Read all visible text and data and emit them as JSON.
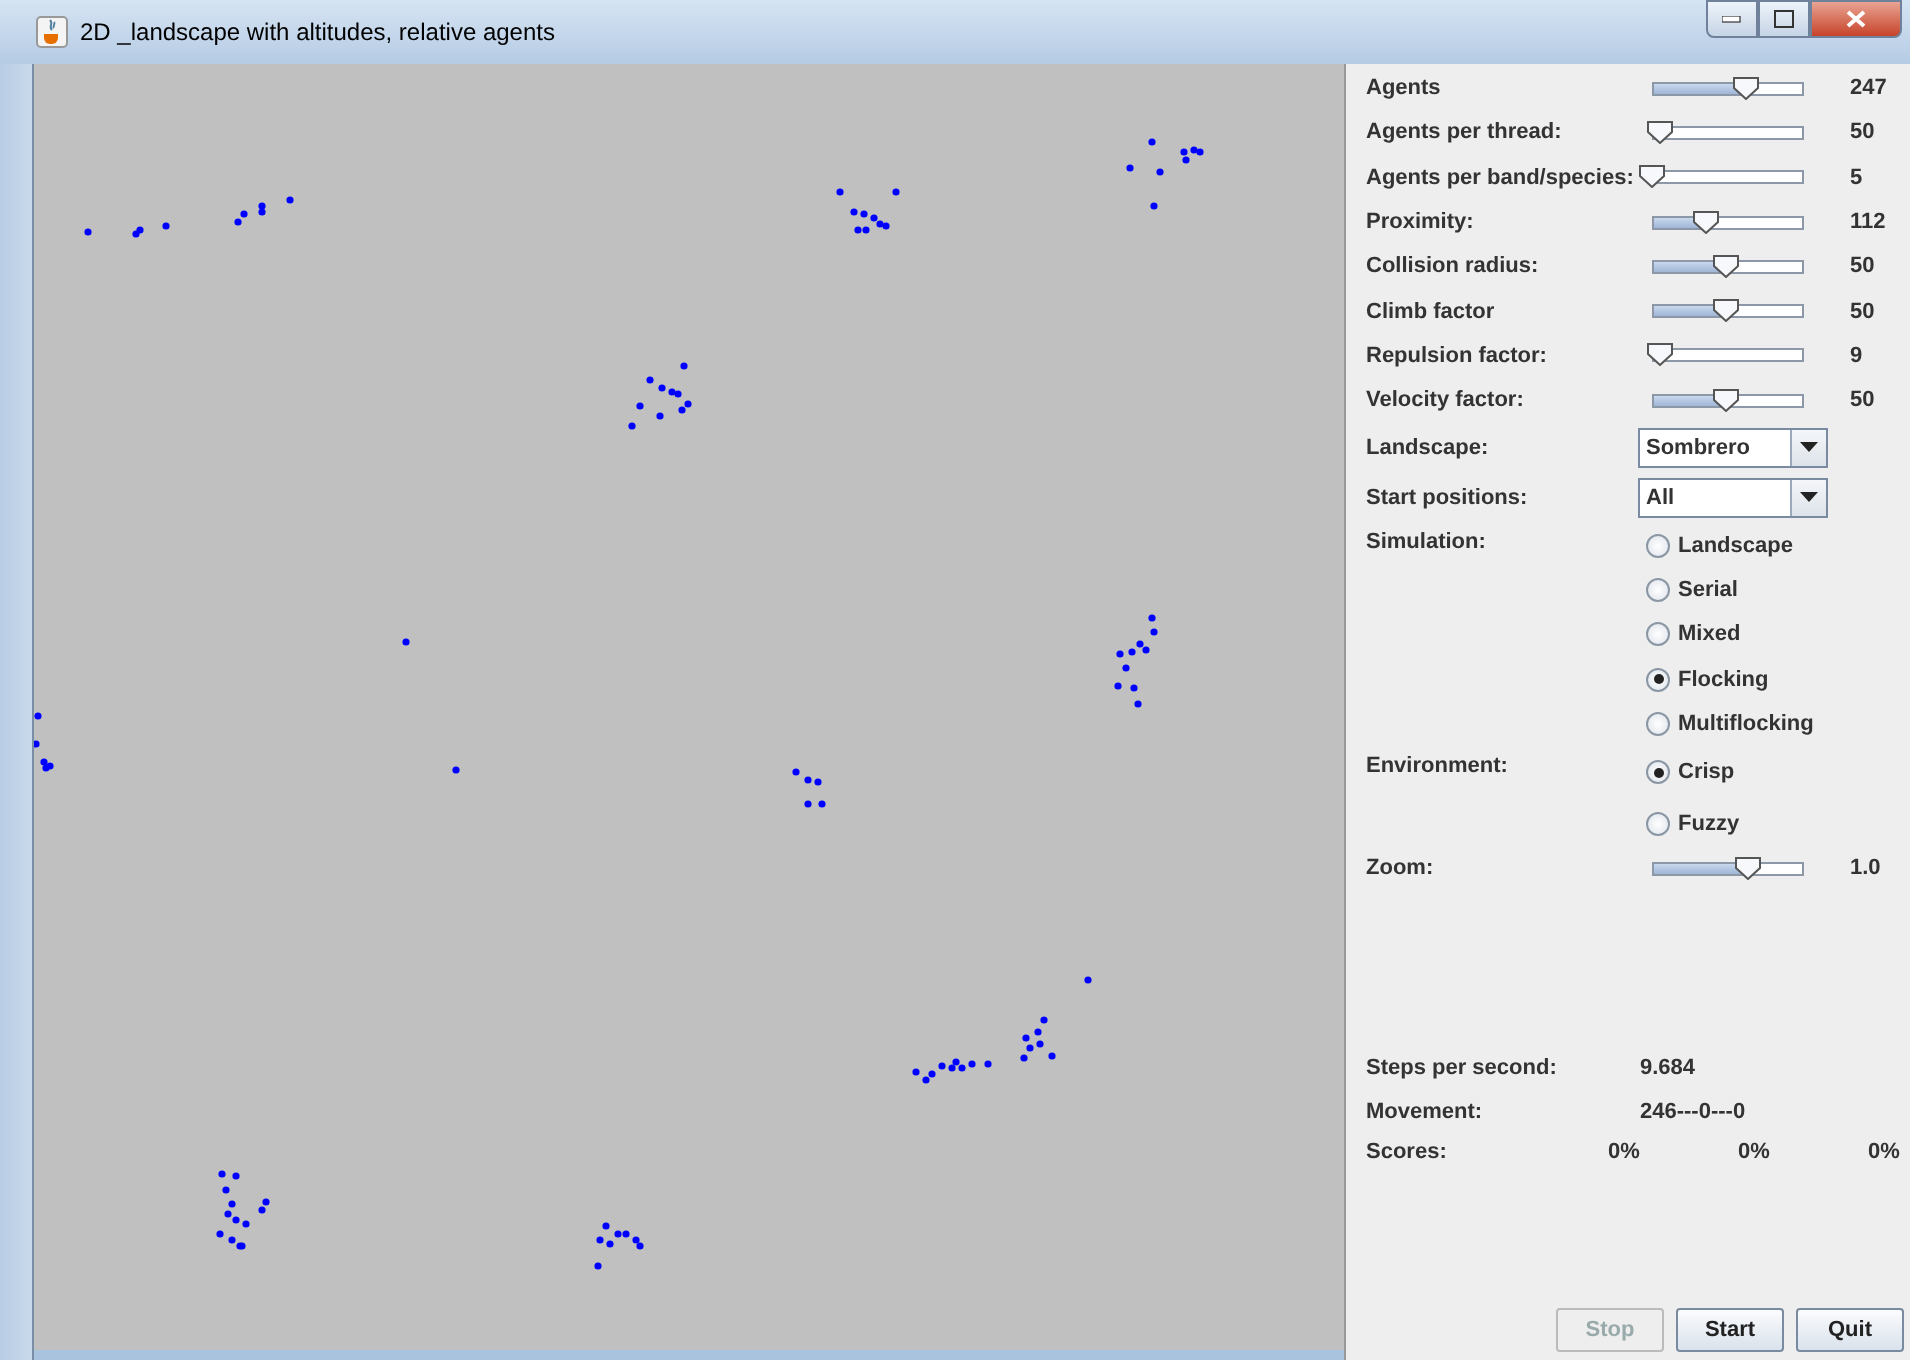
{
  "window": {
    "title": "2D _landscape with altitudes, relative agents"
  },
  "sliders": [
    {
      "label": "Agents",
      "level": 0.63,
      "reading": "247"
    },
    {
      "label": "Agents per thread:",
      "level": 0.06,
      "reading": "50"
    },
    {
      "label": "Agents per band/species:",
      "level": 0.0,
      "reading": "5"
    },
    {
      "label": "Proximity:",
      "level": 0.37,
      "reading": "112"
    },
    {
      "label": "Collision radius:",
      "level": 0.5,
      "reading": "50"
    },
    {
      "label": "Climb factor",
      "level": 0.5,
      "reading": "50"
    },
    {
      "label": "Repulsion factor:",
      "level": 0.06,
      "reading": "9"
    },
    {
      "label": "Velocity factor:",
      "level": 0.5,
      "reading": "50"
    }
  ],
  "dropdowns": [
    {
      "label": "Landscape:",
      "value": "Sombrero"
    },
    {
      "label": "Start positions:",
      "value": "All"
    }
  ],
  "simulation": {
    "label": "Simulation:",
    "options": [
      {
        "label": "Landscape",
        "selected": false
      },
      {
        "label": "Serial",
        "selected": false
      },
      {
        "label": "Mixed",
        "selected": false
      },
      {
        "label": "Flocking",
        "selected": true
      },
      {
        "label": "Multiflocking",
        "selected": false
      }
    ]
  },
  "environment": {
    "label": "Environment:",
    "options": [
      {
        "label": "Crisp",
        "selected": true
      },
      {
        "label": "Fuzzy",
        "selected": false
      }
    ]
  },
  "zoom": {
    "label": "Zoom:",
    "level": 0.65,
    "reading": "1.0"
  },
  "stats": {
    "steps_label": "Steps per second:",
    "steps": "9.684",
    "movement_label": "Movement:",
    "movement": "246---0---0",
    "scores_label": "Scores:",
    "scores": [
      "0%",
      "0%",
      "0%"
    ]
  },
  "buttons": [
    {
      "label": "Stop",
      "disabled": true
    },
    {
      "label": "Start",
      "disabled": false
    },
    {
      "label": "Quit",
      "disabled": false
    }
  ]
}
